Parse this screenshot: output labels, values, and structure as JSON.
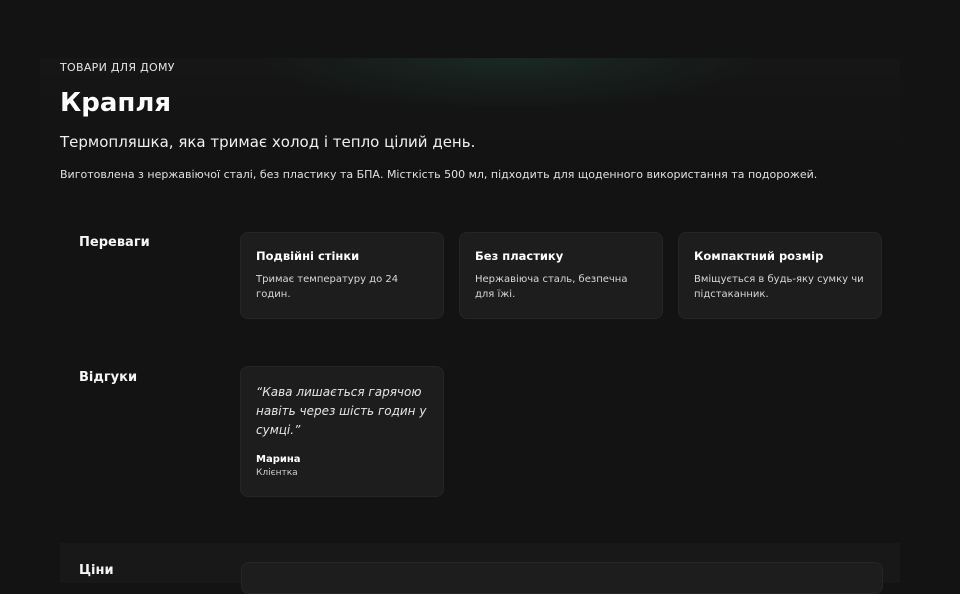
{
  "header": {
    "category": "ТОВАРИ ДЛЯ ДОМУ",
    "title": "Крапля",
    "subtitle": "Термопляшка, яка тримає холод і тепло цілий день.",
    "description": "Виготовлена з нержавіючої сталі, без пластику та БПА. Місткість 500 мл, підходить для щоденного використання та подорожей."
  },
  "benefits": {
    "label": "Переваги",
    "items": [
      {
        "title": "Подвійні стінки",
        "text": "Тримає температуру до 24 годин."
      },
      {
        "title": "Без пластику",
        "text": "Нержавіюча сталь, безпечна для їжі."
      },
      {
        "title": "Компактний розмір",
        "text": "Вміщується в будь-яку сумку чи підстаканник."
      }
    ]
  },
  "reviews": {
    "label": "Відгуки",
    "items": [
      {
        "quote": "“Кава лишається гарячою навіть через шість годин у сумці.”",
        "author": "Марина",
        "role": "Клієнтка"
      }
    ]
  },
  "prices": {
    "label": "Ціни"
  },
  "colors": {
    "background": "#131313",
    "card": "#1d1d1d",
    "accent_glow": "#288c64"
  }
}
